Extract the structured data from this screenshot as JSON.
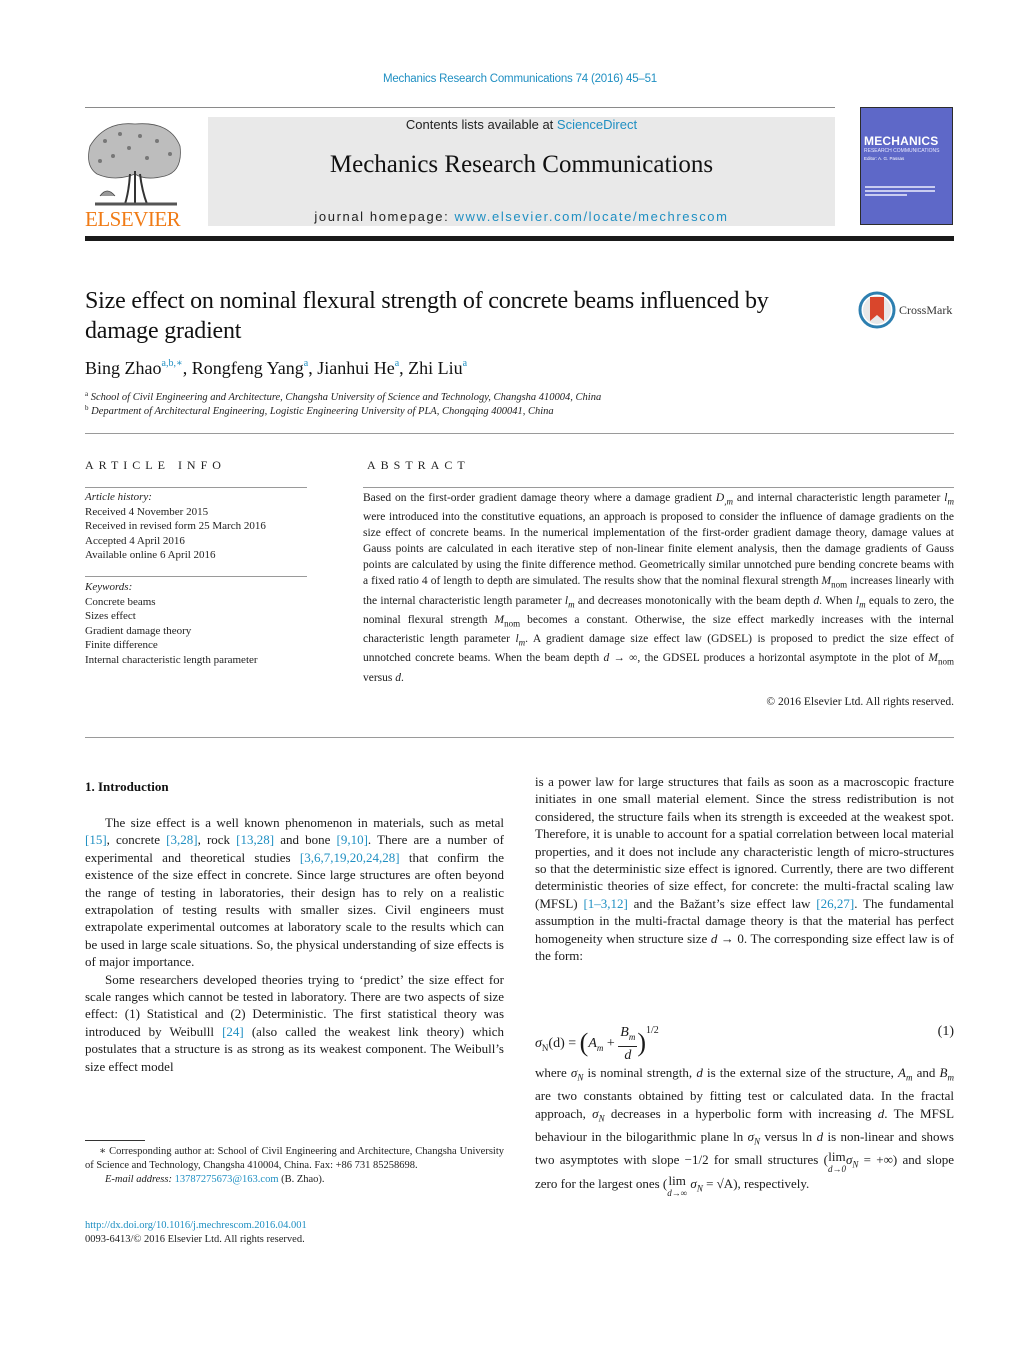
{
  "running_head": "Mechanics Research Communications 74 (2016) 45–51",
  "masthead": {
    "publisher_logo_text": "ELSEVIER",
    "contents_prefix": "Contents lists available at ",
    "contents_link": "ScienceDirect",
    "journal_title": "Mechanics Research Communications",
    "homepage_prefix": "journal homepage: ",
    "homepage_link": "www.elsevier.com/locate/mechrescom",
    "cover": {
      "title": "MECHANICS",
      "subtitle": "RESEARCH COMMUNICATIONS",
      "editor": "Editor: A. G. Passas"
    },
    "colors": {
      "link": "#1f8fc2",
      "elsevier_orange": "#f07b16",
      "cover_blue": "#5e68c8",
      "banner_gray": "#e9e9e9"
    }
  },
  "article": {
    "title": "Size effect on nominal flexural strength of concrete beams influenced by damage gradient",
    "crossmark_label": "CrossMark",
    "authors": [
      {
        "name": "Bing Zhao",
        "marks": "a,b,∗"
      },
      {
        "name": "Rongfeng Yang",
        "marks": "a"
      },
      {
        "name": "Jianhui He",
        "marks": "a"
      },
      {
        "name": "Zhi Liu",
        "marks": "a"
      }
    ],
    "affiliations": [
      {
        "mark": "a",
        "text": "School of Civil Engineering and Architecture, Changsha University of Science and Technology, Changsha 410004, China"
      },
      {
        "mark": "b",
        "text": "Department of Architectural Engineering, Logistic Engineering University of PLA, Chongqing 400041, China"
      }
    ]
  },
  "article_info": {
    "heading": "ARTICLE INFO",
    "history_heading": "Article history:",
    "history": [
      "Received 4 November 2015",
      "Received in revised form 25 March 2016",
      "Accepted 4 April 2016",
      "Available online 6 April 2016"
    ],
    "keywords_heading": "Keywords:",
    "keywords": [
      "Concrete beams",
      "Sizes effect",
      "Gradient damage theory",
      "Finite difference",
      "Internal characteristic length parameter"
    ]
  },
  "abstract": {
    "heading": "ABSTRACT",
    "parts": {
      "p1": "Based on the first-order gradient damage theory where a damage gradient ",
      "v1": "D",
      "v1sub": ",m",
      "p2": " and internal characteristic length parameter ",
      "v2": "l",
      "v2sub": "m",
      "p3": " were introduced into the constitutive equations, an approach is proposed to consider the influence of damage gradients on the size effect of concrete beams. In the numerical implementation of the first-order gradient damage theory, damage values at Gauss points are calculated in each iterative step of non-linear finite element analysis, then the damage gradients of Gauss points are calculated by using the finite difference method. Geometrically similar unnotched pure bending concrete beams with a fixed ratio 4 of length to depth are simulated. The results show that the nominal flexural strength ",
      "mnom": "M",
      "mnomsub": "nom",
      "p4": " increases linearly with the internal characteristic length parameter ",
      "p5": " and decreases monotonically with the beam depth ",
      "d": "d",
      "p6": ". When ",
      "p7": " equals to zero, the nominal flexural strength ",
      "p8": " becomes a constant. Otherwise, the size effect markedly increases with the internal characteristic length parameter ",
      "p9": ". A gradient damage size effect law (GDSEL) is proposed to predict the size effect of unnotched concrete beams. When the beam depth ",
      "arrow_inf": " → ∞",
      "p10": ", the GDSEL produces a horizontal asymptote in the plot of ",
      "p11": " versus ",
      "p12": "."
    },
    "copyright": "© 2016 Elsevier Ltd. All rights reserved."
  },
  "introduction": {
    "heading": "1.  Introduction",
    "para1": {
      "t1": "The size effect is a well known phenomenon in materials, such as metal ",
      "r1": "[15]",
      "t2": ", concrete ",
      "r2": "[3,28]",
      "t3": ", rock ",
      "r3": "[13,28]",
      "t4": " and bone ",
      "r4": "[9,10]",
      "t5": ". There are a number of experimental and theoretical studies ",
      "r5": "[3,6,7,19,20,24,28]",
      "t6": " that confirm the existence of the size effect in concrete. Since large structures are often beyond the range of testing in laboratories, their design has to rely on a realistic extrapolation of testing results with smaller sizes. Civil engineers must extrapolate experimental outcomes at laboratory scale to the results which can be used in large scale situations. So, the physical understanding of size effects is of major importance."
    },
    "para2": {
      "t1": "Some researchers developed theories trying to ‘predict’ the size effect for scale ranges which cannot be tested in laboratory. There are two aspects of size effect: (1) Statistical and (2) Deterministic. The first statistical theory was introduced by Weibulll ",
      "r1": "[24]",
      "t2": " (also called the weakest link theory) which postulates that a structure is as strong as its weakest component. The Weibull’s size effect model"
    },
    "right_para1": {
      "t1": "is a power law for large structures that fails as soon as a macroscopic fracture initiates in one small material element. Since the stress redistribution is not considered, the structure fails when its strength is exceeded at the weakest spot. Therefore, it is unable to account for a spatial correlation between local material properties, and it does not include any characteristic length of micro-structures so that the deterministic size effect is ignored. Currently, there are two different deterministic theories of size effect, for concrete: the multi-fractal scaling law (MFSL) ",
      "r1": "[1–3,12]",
      "t2": " and the Bažant’s size effect law ",
      "r2": "[26,27]",
      "t3": ". The fundamental assumption in the multi-fractal damage theory is that the material has perfect homogeneity when structure size ",
      "t4": " → 0. The corresponding size effect law is of the form:"
    },
    "equation": {
      "lhs": "σ",
      "lhs_sub": "N",
      "lhs_arg": "(d) = ",
      "a": "A",
      "a_sub": "m",
      "plus": " + ",
      "b": "B",
      "b_sub": "m",
      "den": "d",
      "exponent": "1/2",
      "number": "(1)"
    },
    "right_para2": {
      "t1": "where ",
      "t2": " is nominal strength, ",
      "t3": " is the external size of the structure, ",
      "t4": " and ",
      "t5": " are two constants obtained by fitting test or calculated data. In the fractal approach, ",
      "t6": " decreases in a hyperbolic form with increasing ",
      "t7": ". The MFSL behaviour in the bilogarithmic plane ln ",
      "t8": " versus ln ",
      "t9": " is non-linear and shows two asymptotes with slope −1/2 for small structures (",
      "lim": "lim",
      "lim0": "d→0",
      "t10": " = +∞) and slope zero for the largest ones (",
      "liminf": "d→∞",
      "t11": " = √A), respectively."
    }
  },
  "footnotes": {
    "corresponding": "∗  Corresponding author at: School of Civil Engineering and Architecture, Changsha University of Science and Technology, Changsha 410004, China. Fax: +86 731 85258698.",
    "email_label": "E-mail address: ",
    "email": "13787275673@163.com",
    "email_suffix": " (B. Zhao).",
    "doi": "http://dx.doi.org/10.1016/j.mechrescom.2016.04.001",
    "issn": "0093-6413/© 2016 Elsevier Ltd. All rights reserved."
  }
}
